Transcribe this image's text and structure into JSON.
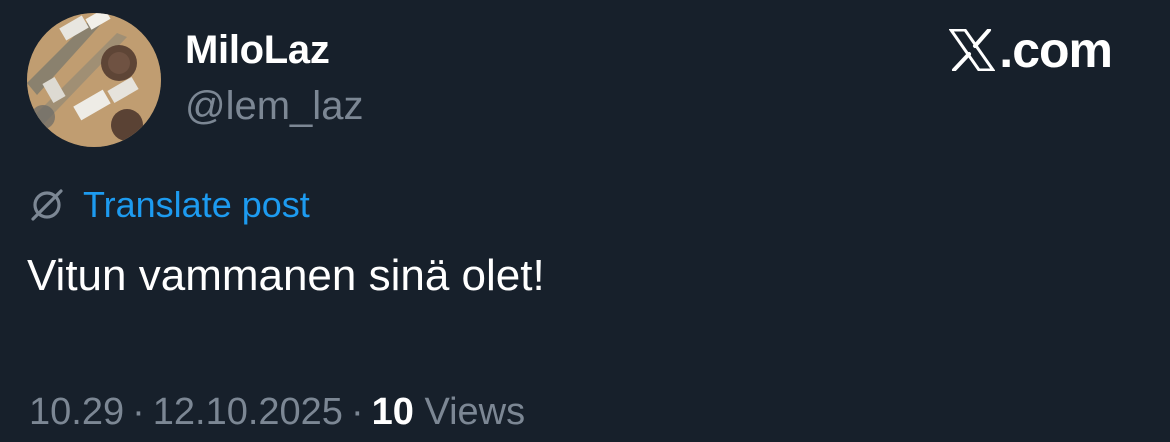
{
  "post": {
    "display_name": "MiloLaz",
    "handle": "@lem_laz",
    "brand": "X.com",
    "brand_text": ".com",
    "translate_label": "Translate post",
    "text": "Vitun vammanen sinä olet!",
    "time": "10.29",
    "separator": "·",
    "date": "12.10.2025",
    "views_count": "10",
    "views_label": "Views"
  },
  "icons": {
    "avatar": "avatar-beach-photo",
    "brand": "x-logo-icon",
    "translate": "globe-slash-icon"
  },
  "colors": {
    "background": "#17202b",
    "primary_text": "#ffffff",
    "secondary_text": "#7c8794",
    "link": "#1d9bf0"
  }
}
